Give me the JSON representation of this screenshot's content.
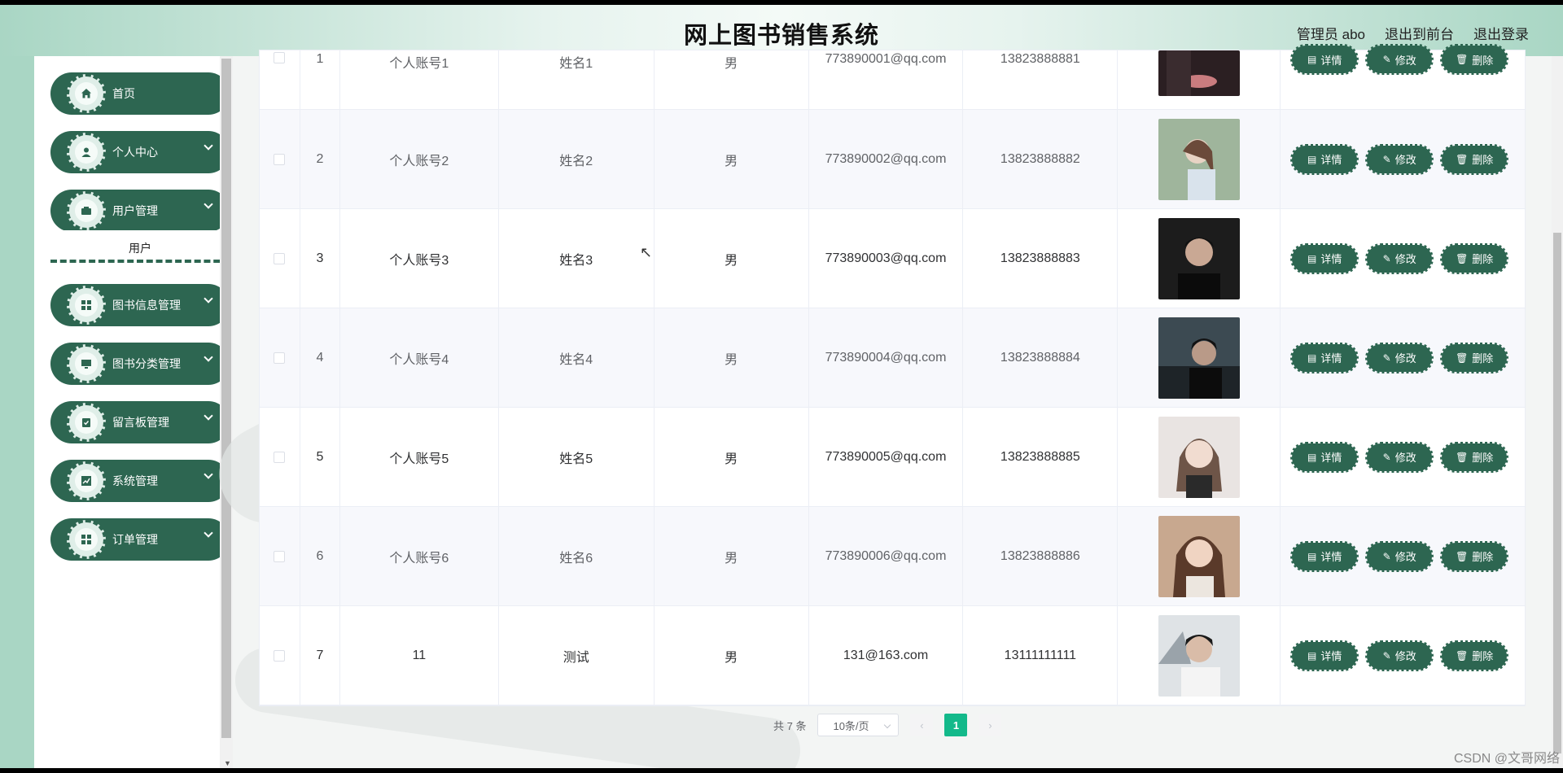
{
  "header": {
    "title": "网上图书销售系统",
    "admin_label": "管理员 abo",
    "to_front_label": "退出到前台",
    "logout_label": "退出登录"
  },
  "sidebar": {
    "items": [
      {
        "label": "首页",
        "icon": "home-icon"
      },
      {
        "label": "个人中心",
        "icon": "user-icon"
      },
      {
        "label": "用户管理",
        "icon": "wallet-icon"
      },
      {
        "label": "图书信息管理",
        "icon": "grid-icon"
      },
      {
        "label": "图书分类管理",
        "icon": "monitor-icon"
      },
      {
        "label": "留言板管理",
        "icon": "clipboard-icon"
      },
      {
        "label": "系统管理",
        "icon": "chart-icon"
      },
      {
        "label": "订单管理",
        "icon": "grid-icon"
      }
    ],
    "submenu_user": "用户"
  },
  "table": {
    "rows": [
      {
        "idx": "1",
        "account": "个人账号1",
        "name": "姓名1",
        "sex": "男",
        "email": "773890001@qq.com",
        "phone": "13823888881"
      },
      {
        "idx": "2",
        "account": "个人账号2",
        "name": "姓名2",
        "sex": "男",
        "email": "773890002@qq.com",
        "phone": "13823888882"
      },
      {
        "idx": "3",
        "account": "个人账号3",
        "name": "姓名3",
        "sex": "男",
        "email": "773890003@qq.com",
        "phone": "13823888883"
      },
      {
        "idx": "4",
        "account": "个人账号4",
        "name": "姓名4",
        "sex": "男",
        "email": "773890004@qq.com",
        "phone": "13823888884"
      },
      {
        "idx": "5",
        "account": "个人账号5",
        "name": "姓名5",
        "sex": "男",
        "email": "773890005@qq.com",
        "phone": "13823888885"
      },
      {
        "idx": "6",
        "account": "个人账号6",
        "name": "姓名6",
        "sex": "男",
        "email": "773890006@qq.com",
        "phone": "13823888886"
      },
      {
        "idx": "7",
        "account": "11",
        "name": "测试",
        "sex": "男",
        "email": "131@163.com",
        "phone": "13111111111"
      }
    ],
    "actions": {
      "detail": "详情",
      "edit": "修改",
      "delete": "删除"
    }
  },
  "pagination": {
    "total_label": "共 7 条",
    "page_size": "10条/页",
    "current_page": "1"
  },
  "watermark": "CSDN @文哥网络",
  "colors": {
    "primary": "#2d6651",
    "accent": "#13b98a",
    "header_bg": "#a9d6c4"
  }
}
